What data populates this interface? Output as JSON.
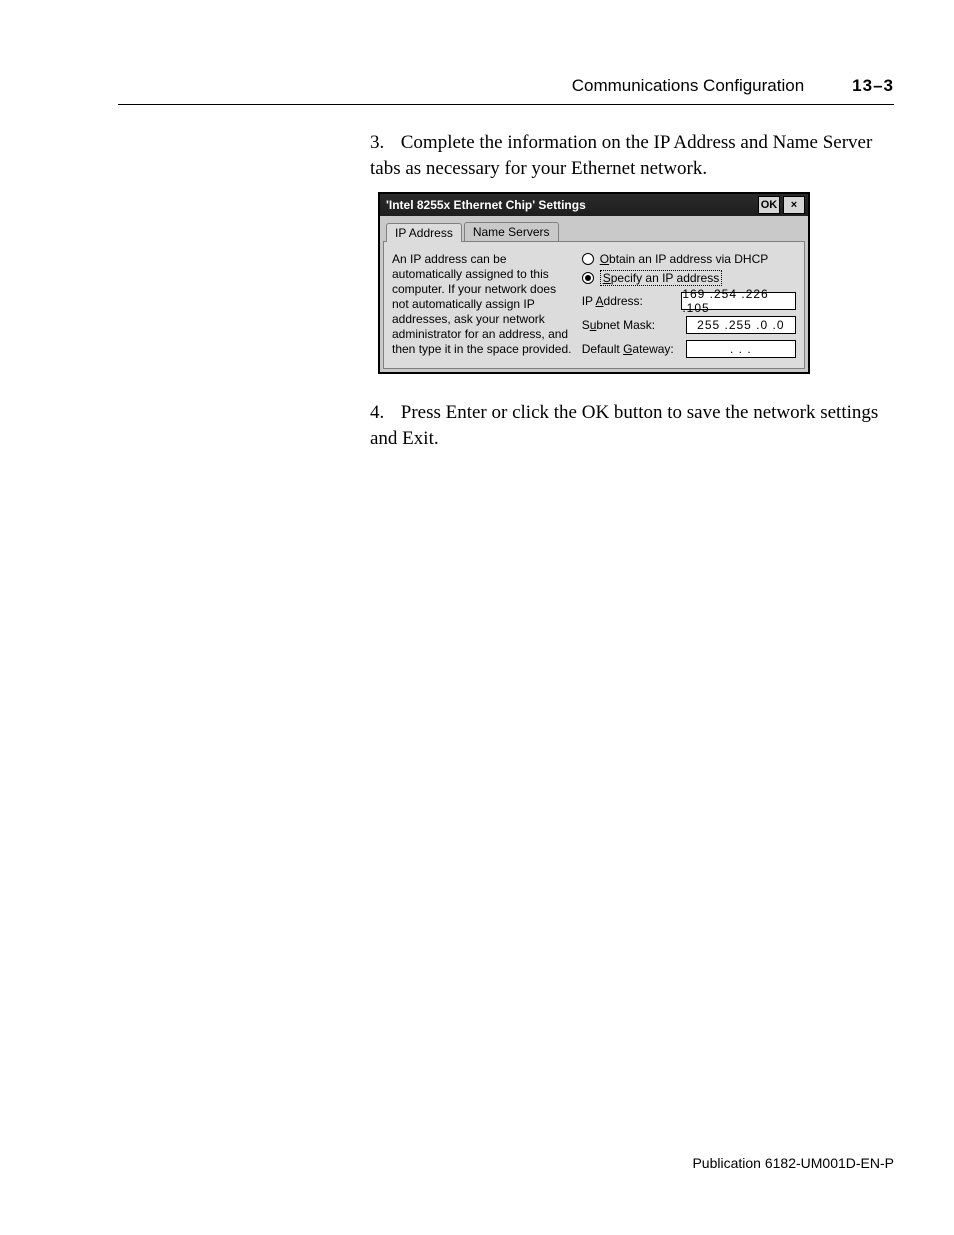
{
  "header": {
    "section_title": "Communications Configuration",
    "page_number": "13–3"
  },
  "steps": {
    "s3_num": "3.",
    "s3_text": "Complete the information on the IP Address and Name Server tabs as necessary for your Ethernet network.",
    "s4_num": "4.",
    "s4_text": "Press Enter or click the OK button to save the network settings and Exit."
  },
  "dialog": {
    "title": "'Intel 8255x Ethernet Chip' Settings",
    "ok_label": "OK",
    "close_label": "×",
    "tabs": {
      "ip": "IP Address",
      "ns": "Name Servers"
    },
    "help_text": "An IP address can be automatically assigned to this computer.  If your network does not automatically assign IP addresses, ask your network administrator for an address, and then type it in the space provided.",
    "radio": {
      "dhcp_pre": "O",
      "dhcp_u": "O",
      "dhcp_post": "btain an IP address via DHCP",
      "spec_pre": "S",
      "spec_u": "S",
      "spec_post": "pecify an IP address"
    },
    "fields": {
      "ip_label_pre": "IP ",
      "ip_label_u": "A",
      "ip_label_post": "ddress:",
      "subnet_label_pre": "S",
      "subnet_label_u": "u",
      "subnet_label_post": "bnet Mask:",
      "gw_label_pre": "Default ",
      "gw_label_u": "G",
      "gw_label_post": "ateway:",
      "ip_value": "169 .254 .226 .105",
      "subnet_value": "255 .255 .0    .0",
      "gw_value": ".        .        ."
    }
  },
  "footer": {
    "pub": "Publication 6182-UM001D-EN-P"
  }
}
